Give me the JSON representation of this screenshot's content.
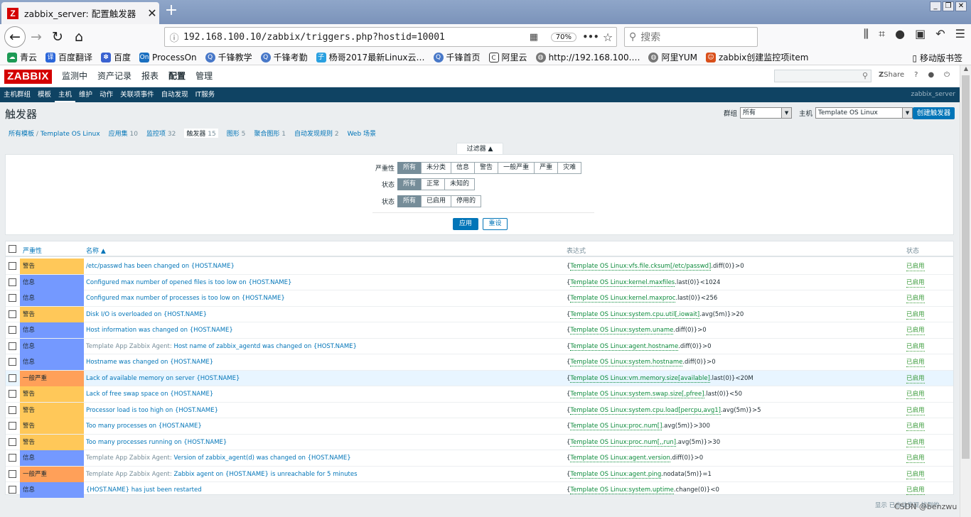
{
  "browser": {
    "tab_title": "zabbix_server: 配置触发器",
    "url": "192.168.100.10/zabbix/triggers.php?hostid=10001",
    "zoom": "70%",
    "search_placeholder": "搜索",
    "mobile_bookmarks": "移动版书签",
    "bookmarks": [
      "青云",
      "百度翻译",
      "百度",
      "ProcessOn",
      "千锋教学",
      "千锋考勤",
      "杨哥2017最新Linux云…",
      "千锋首页",
      "阿里云",
      "http://192.168.100.…",
      "阿里YUM",
      "zabbix创建监控项item"
    ]
  },
  "zabbix": {
    "logo": "ZABBIX",
    "menu": [
      "监测中",
      "资产记录",
      "报表",
      "配置",
      "管理"
    ],
    "share": "Share",
    "server_name": "zabbix_server",
    "submenu": [
      "主机群组",
      "模板",
      "主机",
      "维护",
      "动作",
      "关联项事件",
      "自动发现",
      "IT服务"
    ]
  },
  "page": {
    "title": "触发器",
    "group_label": "群组",
    "group_value": "所有",
    "host_label": "主机",
    "host_value": "Template OS Linux",
    "create_button": "创建触发器",
    "breadcrumb": {
      "all": "所有模板",
      "sep": "/",
      "host": "Template OS Linux",
      "apps": "应用集",
      "apps_n": "10",
      "items": "监控项",
      "items_n": "32",
      "triggers": "触发器",
      "triggers_n": "15",
      "graphs": "图形",
      "graphs_n": "5",
      "screens": "聚合图形",
      "screens_n": "1",
      "discovery": "自动发现规则",
      "discovery_n": "2",
      "web": "Web 场景"
    },
    "filter": {
      "tab": "过滤器 ▲",
      "severity_label": "严重性",
      "severity": [
        "所有",
        "未分类",
        "信息",
        "警告",
        "一般严重",
        "严重",
        "灾难"
      ],
      "state_label": "状态",
      "state": [
        "所有",
        "正常",
        "未知的"
      ],
      "status_label": "状态",
      "status": [
        "所有",
        "已启用",
        "停用的"
      ],
      "apply": "应用",
      "reset": "重设"
    },
    "table": {
      "headers": {
        "severity": "严重性",
        "name": "名称 ▲",
        "expression": "表达式",
        "status": "状态"
      },
      "rows": [
        {
          "sev": "警告",
          "cls": "warn",
          "pre": "",
          "name": "/etc/passwd has been changed on {HOST.NAME}",
          "e1": "{",
          "ei": "Template OS Linux:vfs.file.cksum[/etc/passwd]",
          "e2": ".diff(0)}>0",
          "status": "已启用"
        },
        {
          "sev": "信息",
          "cls": "info",
          "pre": "",
          "name": "Configured max number of opened files is too low on {HOST.NAME}",
          "e1": "{",
          "ei": "Template OS Linux:kernel.maxfiles",
          "e2": ".last(0)}<1024",
          "status": "已启用"
        },
        {
          "sev": "信息",
          "cls": "info",
          "pre": "",
          "name": "Configured max number of processes is too low on {HOST.NAME}",
          "e1": "{",
          "ei": "Template OS Linux:kernel.maxproc",
          "e2": ".last(0)}<256",
          "status": "已启用"
        },
        {
          "sev": "警告",
          "cls": "warn",
          "pre": "",
          "name": "Disk I/O is overloaded on {HOST.NAME}",
          "e1": "{",
          "ei": "Template OS Linux:system.cpu.util[,iowait]",
          "e2": ".avg(5m)}>20",
          "status": "已启用"
        },
        {
          "sev": "信息",
          "cls": "info",
          "pre": "",
          "name": "Host information was changed on {HOST.NAME}",
          "e1": "{",
          "ei": "Template OS Linux:system.uname",
          "e2": ".diff(0)}>0",
          "status": "已启用"
        },
        {
          "sev": "信息",
          "cls": "info",
          "pre": "Template App Zabbix Agent: ",
          "name": "Host name of zabbix_agentd was changed on {HOST.NAME}",
          "e1": "{",
          "ei": "Template OS Linux:agent.hostname",
          "e2": ".diff(0)}>0",
          "status": "已启用"
        },
        {
          "sev": "信息",
          "cls": "info",
          "pre": "",
          "name": "Hostname was changed on {HOST.NAME}",
          "e1": "{",
          "ei": "Template OS Linux:system.hostname",
          "e2": ".diff(0)}>0",
          "status": "已启用"
        },
        {
          "sev": "一般严重",
          "cls": "avg",
          "pre": "",
          "name": "Lack of available memory on server {HOST.NAME}",
          "e1": "{",
          "ei": "Template OS Linux:vm.memory.size[available]",
          "e2": ".last(0)}<20M",
          "status": "已启用"
        },
        {
          "sev": "警告",
          "cls": "warn",
          "pre": "",
          "name": "Lack of free swap space on {HOST.NAME}",
          "e1": "{",
          "ei": "Template OS Linux:system.swap.size[,pfree]",
          "e2": ".last(0)}<50",
          "status": "已启用"
        },
        {
          "sev": "警告",
          "cls": "warn",
          "pre": "",
          "name": "Processor load is too high on {HOST.NAME}",
          "e1": "{",
          "ei": "Template OS Linux:system.cpu.load[percpu,avg1]",
          "e2": ".avg(5m)}>5",
          "status": "已启用"
        },
        {
          "sev": "警告",
          "cls": "warn",
          "pre": "",
          "name": "Too many processes on {HOST.NAME}",
          "e1": "{",
          "ei": "Template OS Linux:proc.num[]",
          "e2": ".avg(5m)}>300",
          "status": "已启用"
        },
        {
          "sev": "警告",
          "cls": "warn",
          "pre": "",
          "name": "Too many processes running on {HOST.NAME}",
          "e1": "{",
          "ei": "Template OS Linux:proc.num[,,run]",
          "e2": ".avg(5m)}>30",
          "status": "已启用"
        },
        {
          "sev": "信息",
          "cls": "info",
          "pre": "Template App Zabbix Agent: ",
          "name": "Version of zabbix_agent(d) was changed on {HOST.NAME}",
          "e1": "{",
          "ei": "Template OS Linux:agent.version",
          "e2": ".diff(0)}>0",
          "status": "已启用"
        },
        {
          "sev": "一般严重",
          "cls": "avg",
          "pre": "Template App Zabbix Agent: ",
          "name": "Zabbix agent on {HOST.NAME} is unreachable for 5 minutes",
          "e1": "{",
          "ei": "Template OS Linux:agent.ping",
          "e2": ".nodata(5m)}=1",
          "status": "已启用"
        },
        {
          "sev": "信息",
          "cls": "info",
          "pre": "",
          "name": "{HOST.NAME} has just been restarted",
          "e1": "{",
          "ei": "Template OS Linux:system.uptime",
          "e2": ".change(0)}<0",
          "status": "已启用"
        }
      ]
    },
    "footer": "显示 已自动发现 找到的",
    "watermark": "CSDN @benzwu"
  },
  "colors": {
    "warn": "#ffc859",
    "info": "#7499ff",
    "avg": "#ffa059",
    "brand": "#d40000",
    "nav": "#0f4363",
    "link": "#0275b8"
  }
}
